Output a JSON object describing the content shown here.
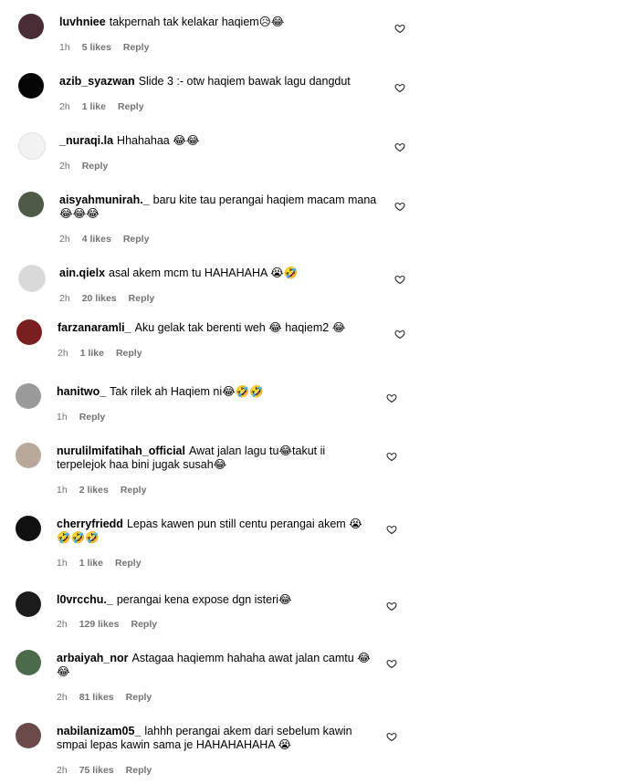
{
  "comments": [
    {
      "user": "luvhniee",
      "text": "takpernah tak kelakar haqiem😥😂",
      "time": "1h",
      "likes": "5 likes",
      "reply": "Reply",
      "avatar": "#4a2c35"
    },
    {
      "user": "azib_syazwan",
      "text": "Slide 3 :- otw haqiem bawak lagu dangdut",
      "time": "2h",
      "likes": "1 like",
      "reply": "Reply",
      "avatar": "#050505"
    },
    {
      "user": "_nuraqi.la",
      "text": "Hhahahaa 😂😂",
      "time": "2h",
      "likes": "",
      "reply": "Reply",
      "avatar": "#f2f2f2"
    },
    {
      "user": "aisyahmunirah._",
      "text": "baru kite tau perangai haqiem macam mana 😂😂😂",
      "time": "2h",
      "likes": "4 likes",
      "reply": "Reply",
      "avatar": "#4d5a46"
    },
    {
      "user": "ain.qielx",
      "text": "asal akem mcm tu HAHAHAHA 😭🤣",
      "time": "2h",
      "likes": "20 likes",
      "reply": "Reply",
      "avatar": "#d9d9d9"
    },
    {
      "user": "farzanaramli_",
      "text": "Aku gelak tak berenti weh 😂 haqiem2 😂",
      "time": "2h",
      "likes": "1 like",
      "reply": "Reply",
      "avatar": "#7a1f1f"
    },
    {
      "user": "hanitwo_",
      "text": "Tak rilek ah Haqiem ni😂🤣🤣",
      "time": "1h",
      "likes": "",
      "reply": "Reply",
      "avatar": "#9a9a9a"
    },
    {
      "user": "nurulilmifatihah_official",
      "text": "Awat jalan lagu tu😂takut ii terpelejok haa bini jugak susah😂",
      "time": "1h",
      "likes": "2 likes",
      "reply": "Reply",
      "avatar": "#b8a89a"
    },
    {
      "user": "cherryfriedd",
      "text": "Lepas kawen pun still centu perangai akem 😭🤣🤣🤣",
      "time": "1h",
      "likes": "1 like",
      "reply": "Reply",
      "avatar": "#111111"
    },
    {
      "user": "l0vrcchu._",
      "text": "perangai kena expose dgn isteri😂",
      "time": "2h",
      "likes": "129 likes",
      "reply": "Reply",
      "avatar": "#1c1c1c"
    },
    {
      "user": "arbaiyah_nor",
      "text": "Astagaa haqiemm hahaha awat jalan camtu 😂😂",
      "time": "2h",
      "likes": "81 likes",
      "reply": "Reply",
      "avatar": "#4b6b4a"
    },
    {
      "user": "nabilanizam05_",
      "text": "lahhh perangai akem dari sebelum kawin smpai lepas kawin sama je HAHAHAHAHA 😭",
      "time": "2h",
      "likes": "75 likes",
      "reply": "Reply",
      "avatar": "#6b4a4a"
    }
  ]
}
